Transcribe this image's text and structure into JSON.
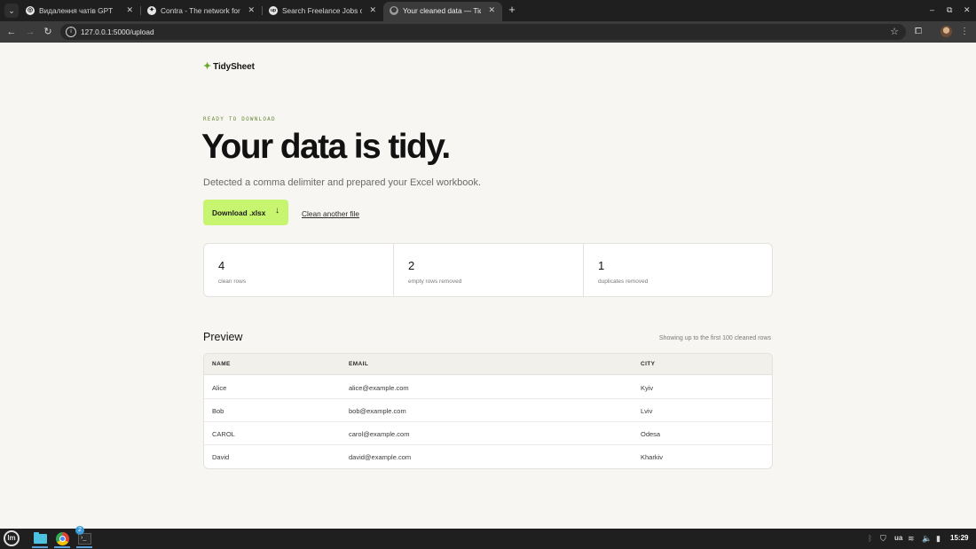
{
  "browser": {
    "tabs": [
      {
        "title": "Видалення чатів GPT",
        "favicon": "openai-icon"
      },
      {
        "title": "Contra - The network for cre",
        "favicon": "contra-icon"
      },
      {
        "title": "Search Freelance Jobs on Up",
        "favicon": "upwork-icon"
      },
      {
        "title": "Your cleaned data — TidySh",
        "favicon": "globe-icon",
        "active": true
      }
    ],
    "url": "127.0.0.1:5000/upload"
  },
  "page": {
    "brand": "TidySheet",
    "eyebrow": "READY TO DOWNLOAD",
    "headline": "Your data is tidy.",
    "subline": "Detected a comma delimiter and prepared your Excel workbook.",
    "download_label": "Download .xlsx",
    "clean_another_label": "Clean another file",
    "stats": [
      {
        "value": "4",
        "label": "clean rows"
      },
      {
        "value": "2",
        "label": "empty rows removed"
      },
      {
        "value": "1",
        "label": "duplicates removed"
      }
    ],
    "preview": {
      "title": "Preview",
      "note": "Showing up to the first 100 cleaned rows",
      "columns": [
        "NAME",
        "EMAIL",
        "CITY"
      ],
      "rows": [
        [
          "Alice",
          "alice@example.com",
          "Kyiv"
        ],
        [
          "Bob",
          "bob@example.com",
          "Lviv"
        ],
        [
          "CAROL",
          "carol@example.com",
          "Odesa"
        ],
        [
          "David",
          "david@example.com",
          "Kharkiv"
        ]
      ]
    }
  },
  "taskbar": {
    "badge_count": "2",
    "keyboard_layout": "ua",
    "clock": "15:29"
  },
  "colors": {
    "accent": "#c7f56f",
    "brand_spark": "#6aaa2a",
    "background": "#f7f6f2"
  }
}
